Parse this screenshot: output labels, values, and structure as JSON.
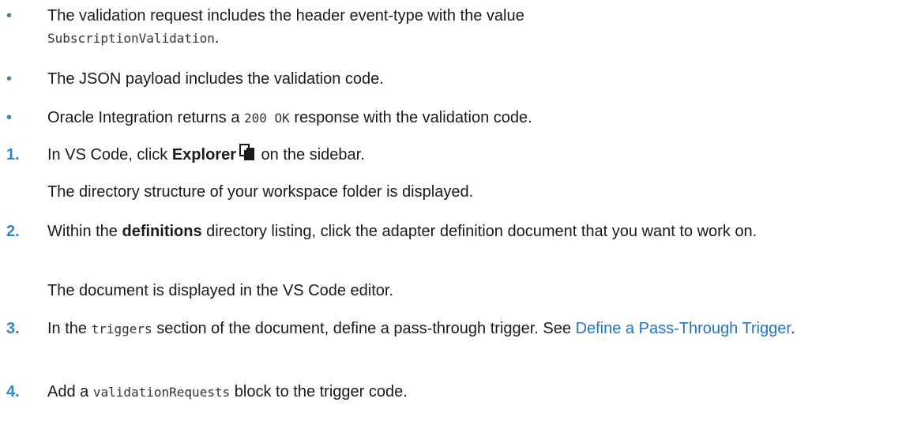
{
  "bullets": [
    {
      "text_before": "The validation request includes the header event-type with the value ",
      "code": "SubscriptionValidation",
      "text_after": "."
    },
    {
      "text": "The JSON payload includes the validation code."
    },
    {
      "text_before": "Oracle Integration returns a ",
      "code": "200 OK",
      "text_after": " response with the validation code."
    }
  ],
  "steps": [
    {
      "number": "1.",
      "text_before": "In VS Code, click ",
      "bold": "Explorer",
      "icon": "explorer-icon",
      "text_after": " on the sidebar.",
      "result": "The directory structure of your workspace folder is displayed."
    },
    {
      "number": "2.",
      "text_before": "Within the ",
      "bold": "definitions",
      "text_after": " directory listing, click the adapter definition document that you want to work on.",
      "result": "The document is displayed in the VS Code editor."
    },
    {
      "number": "3.",
      "text_before": "In the ",
      "code": "triggers",
      "text_middle": " section of the document, define a pass-through trigger. See ",
      "link": "Define a Pass-Through Trigger",
      "text_after": "."
    },
    {
      "number": "4.",
      "text_before": "Add a ",
      "code": "validationRequests",
      "text_after": " block to the trigger code."
    }
  ],
  "colors": {
    "accent": "#2e87c8",
    "link": "#1f73c4",
    "text": "#1a1a1a"
  }
}
